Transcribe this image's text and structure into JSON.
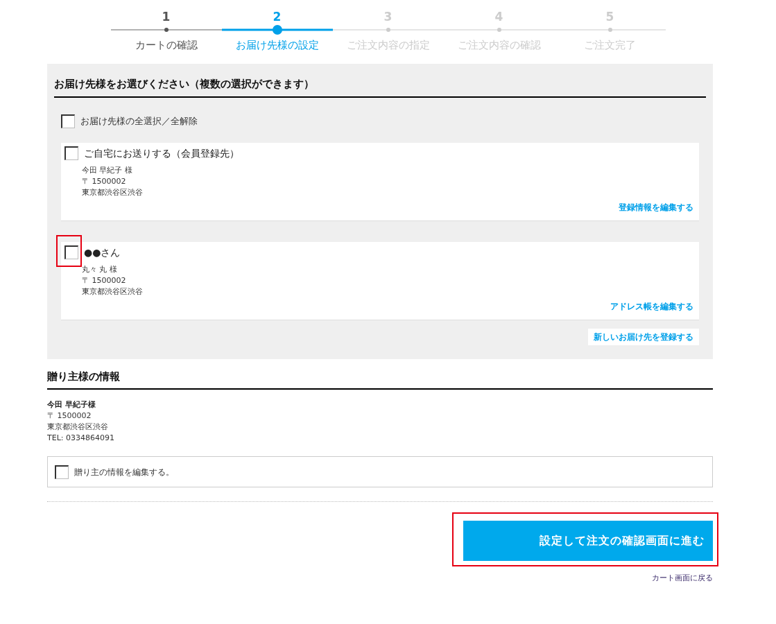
{
  "steps": [
    {
      "number": "1",
      "label": "カートの確認",
      "selected": false
    },
    {
      "number": "2",
      "label": "お届け先様の設定",
      "selected": true
    },
    {
      "number": "3",
      "label": "ご注文内容の指定",
      "selected": false
    },
    {
      "number": "4",
      "label": "ご注文内容の確認",
      "selected": false
    },
    {
      "number": "5",
      "label": "ご注文完了",
      "selected": false
    }
  ],
  "recipients": {
    "heading": "お届け先様をお選びください（複数の選択ができます）",
    "select_all": {
      "label": "お届け先様の全選択／全解除",
      "checked": false
    },
    "addresses": [
      {
        "title": "ご自宅にお送りする（会員登録先）",
        "checked": false,
        "highlighted": false,
        "lines": [
          "今田 早紀子 様",
          "〒 1500002",
          "東京都渋谷区渋谷"
        ],
        "edit_link": "登録情報を編集する"
      },
      {
        "title": "●●さん",
        "checked": false,
        "highlighted": true,
        "lines": [
          "丸々 丸 様",
          "〒 1500002",
          "東京都渋谷区渋谷"
        ],
        "edit_link": "アドレス帳を編集する"
      }
    ],
    "new_address_button": "新しいお届け先を登録する"
  },
  "sender": {
    "heading": "贈り主様の情報",
    "name": "今田 早紀子様",
    "lines": [
      "〒 1500002",
      "東京都渋谷区渋谷",
      "TEL: 0334864091"
    ],
    "edit_option": {
      "label": "贈り主の情報を編集する。",
      "checked": false
    }
  },
  "submit_button": {
    "label": "設定して注文の確認画面に進む",
    "highlighted": true
  },
  "back_link": "カート画面に戻る"
}
